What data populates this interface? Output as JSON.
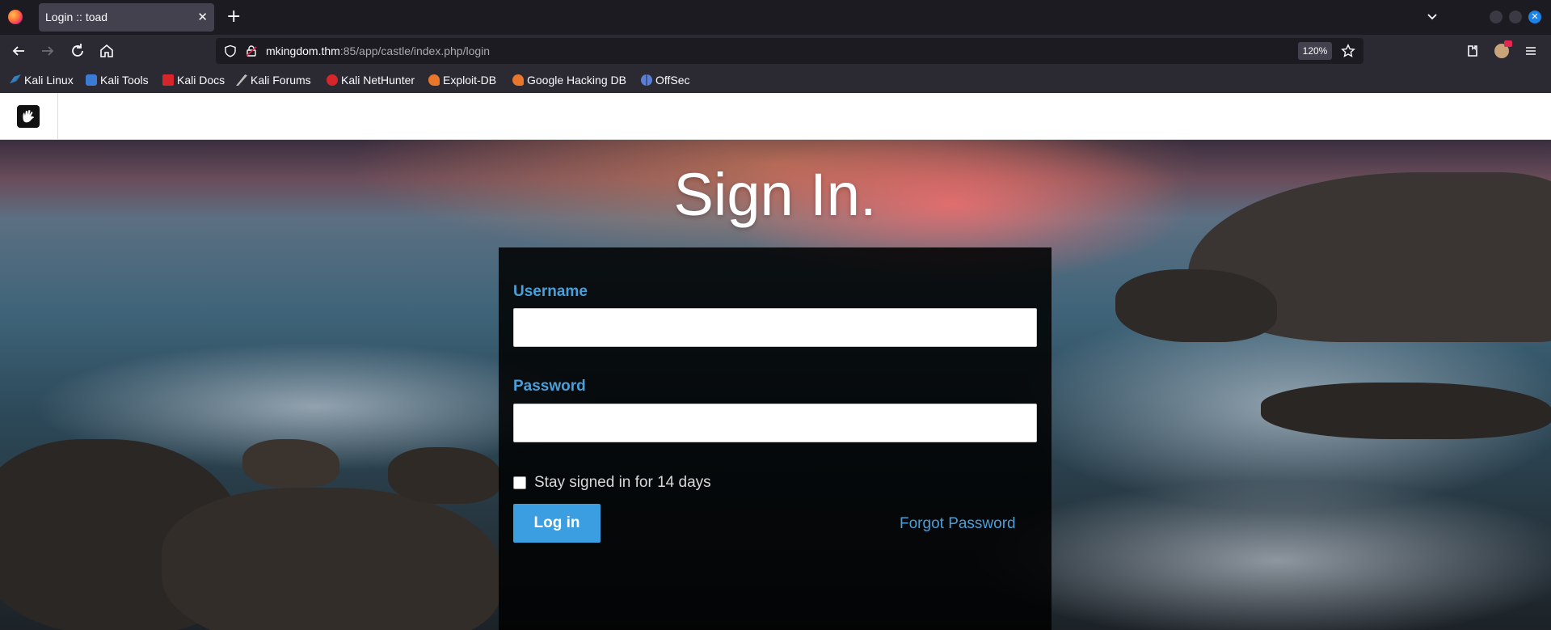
{
  "browser": {
    "tab_title": "Login :: toad",
    "url_host": "mkingdom.thm",
    "url_path": ":85/app/castle/index.php/login",
    "zoom": "120%",
    "bookmarks": [
      {
        "label": "Kali Linux",
        "icon": "kali-dragon-icon"
      },
      {
        "label": "Kali Tools",
        "icon": "kali-tools-icon"
      },
      {
        "label": "Kali Docs",
        "icon": "kali-docs-icon"
      },
      {
        "label": "Kali Forums",
        "icon": "kali-forums-icon"
      },
      {
        "label": "Kali NetHunter",
        "icon": "nethunter-icon"
      },
      {
        "label": "Exploit-DB",
        "icon": "exploit-db-icon"
      },
      {
        "label": "Google Hacking DB",
        "icon": "ghdb-icon"
      },
      {
        "label": "OffSec",
        "icon": "offsec-icon"
      }
    ]
  },
  "page": {
    "title": "Sign In.",
    "username_label": "Username",
    "username_value": "",
    "password_label": "Password",
    "password_value": "",
    "remember_label": "Stay signed in for 14 days",
    "remember_checked": false,
    "login_button": "Log in",
    "forgot_link": "Forgot Password"
  },
  "colors": {
    "accent": "#3b9ee0",
    "label": "#4a9fd9",
    "panel": "#000000",
    "chrome_dark": "#1c1b22",
    "chrome": "#2b2a33"
  }
}
